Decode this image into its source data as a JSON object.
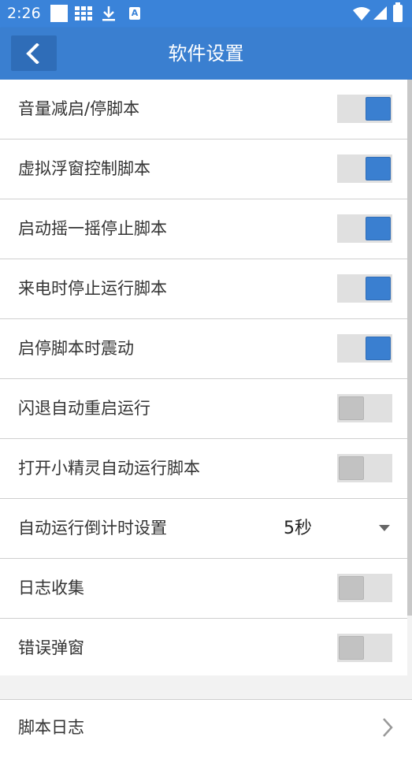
{
  "status_bar": {
    "time": "2:26",
    "icons": [
      "white-square-icon",
      "grid-icon",
      "download-icon",
      "a-notification-icon",
      "wifi-icon",
      "signal-icon",
      "battery-icon"
    ],
    "a_icon_text": "A"
  },
  "app_bar": {
    "title": "软件设置",
    "back_icon": "chevron-left-icon"
  },
  "colors": {
    "status_bar": "#3a83d9",
    "app_bar": "#3a7fd0",
    "toggle_on": "#3a7fd0",
    "toggle_off": "#c2c2c2"
  },
  "settings": [
    {
      "label": "音量减启/停脚本",
      "type": "toggle",
      "on": true
    },
    {
      "label": "虚拟浮窗控制脚本",
      "type": "toggle",
      "on": true
    },
    {
      "label": "启动摇一摇停止脚本",
      "type": "toggle",
      "on": true
    },
    {
      "label": "来电时停止运行脚本",
      "type": "toggle",
      "on": true
    },
    {
      "label": "启停脚本时震动",
      "type": "toggle",
      "on": true
    },
    {
      "label": "闪退自动重启运行",
      "type": "toggle",
      "on": false
    },
    {
      "label": "打开小精灵自动运行脚本",
      "type": "toggle",
      "on": false
    },
    {
      "label": "自动运行倒计时设置",
      "type": "select",
      "value": "5秒"
    },
    {
      "label": "日志收集",
      "type": "toggle",
      "on": false
    },
    {
      "label": "错误弹窗",
      "type": "toggle",
      "on": false
    }
  ],
  "secondary": {
    "label": "脚本日志",
    "icon": "chevron-right-icon"
  }
}
